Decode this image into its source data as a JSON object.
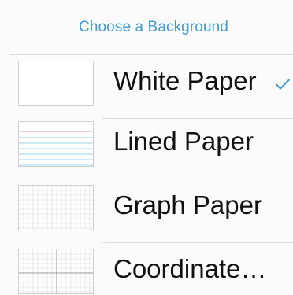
{
  "header": {
    "title": "Choose a Background"
  },
  "options": [
    {
      "label": "White Paper",
      "selected": true,
      "icon": "white-paper-thumbnail"
    },
    {
      "label": "Lined Paper",
      "selected": false,
      "icon": "lined-paper-thumbnail"
    },
    {
      "label": "Graph Paper",
      "selected": false,
      "icon": "graph-paper-thumbnail"
    },
    {
      "label": "Coordinate…",
      "selected": false,
      "icon": "coordinate-paper-thumbnail"
    }
  ],
  "colors": {
    "accent": "#3f9ad6",
    "text": "#111111",
    "divider": "#dcdcdc",
    "background": "#fbfbfb"
  }
}
